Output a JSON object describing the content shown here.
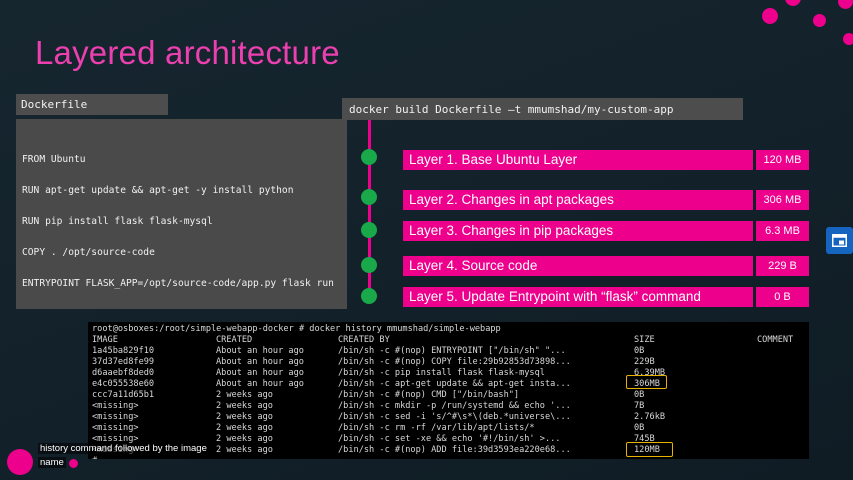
{
  "slide": {
    "title": "Layered architecture",
    "dockerfile_label": "Dockerfile",
    "dockerfile_lines": [
      "FROM Ubuntu",
      "RUN apt-get update && apt-get -y install python",
      "RUN pip install flask flask-mysql",
      "COPY . /opt/source-code",
      "ENTRYPOINT FLASK_APP=/opt/source-code/app.py flask run"
    ],
    "build_command": "docker build Dockerfile –t mmumshad/my-custom-app",
    "layers": [
      {
        "label": "Layer 1. Base Ubuntu Layer",
        "size": "120 MB"
      },
      {
        "label": "Layer 2. Changes in apt packages",
        "size": "306 MB"
      },
      {
        "label": "Layer 3. Changes in pip packages",
        "size": "6.3 MB"
      },
      {
        "label": "Layer 4. Source code",
        "size": "229 B"
      },
      {
        "label": "Layer 5. Update Entrypoint with “flask” command",
        "size": "0 B"
      }
    ]
  },
  "terminal": {
    "prompt": "root@osboxes:/root/simple-webapp-docker # docker history mmumshad/simple-webapp",
    "headers": [
      "IMAGE",
      "CREATED",
      "CREATED BY",
      "SIZE",
      "COMMENT"
    ],
    "rows": [
      [
        "1a45ba829f10",
        "About an hour ago",
        "/bin/sh -c #(nop)  ENTRYPOINT [\"/bin/sh\" \"...",
        "0B",
        ""
      ],
      [
        "37d37ed8fe99",
        "About an hour ago",
        "/bin/sh -c #(nop) COPY file:29b92853d73898...",
        "229B",
        ""
      ],
      [
        "d6aaebf8ded0",
        "About an hour ago",
        "/bin/sh -c pip install flask flask-mysql",
        "6.39MB",
        ""
      ],
      [
        "e4c055538e60",
        "About an hour ago",
        "/bin/sh -c apt-get update && apt-get insta...",
        "306MB",
        ""
      ],
      [
        "ccc7a11d65b1",
        "2 weeks ago",
        "/bin/sh -c #(nop)  CMD [\"/bin/bash\"]",
        "0B",
        ""
      ],
      [
        "<missing>",
        "2 weeks ago",
        "/bin/sh -c mkdir -p /run/systemd && echo '...",
        "7B",
        ""
      ],
      [
        "<missing>",
        "2 weeks ago",
        "/bin/sh -c sed -i 's/^#\\s*\\(deb.*universe\\...",
        "2.76kB",
        ""
      ],
      [
        "<missing>",
        "2 weeks ago",
        "/bin/sh -c rm -rf /var/lib/apt/lists/*",
        "0B",
        ""
      ],
      [
        "<missing>",
        "2 weeks ago",
        "/bin/sh -c set -xe   && echo '#!/bin/sh' >...",
        "745B",
        ""
      ],
      [
        "<missing>",
        "2 weeks ago",
        "/bin/sh -c #(nop) ADD file:39d3593ea220e68...",
        "120MB",
        ""
      ]
    ],
    "cursor": "#"
  },
  "overlay": {
    "caption_line1": "history command followed by the image",
    "caption_line2": "name"
  },
  "colors": {
    "accent": "#ec008c",
    "node": "#19a84a",
    "highlight": "#e8b200",
    "side_button": "#1565c0"
  },
  "icons": {
    "side_button": "window-share-icon"
  }
}
